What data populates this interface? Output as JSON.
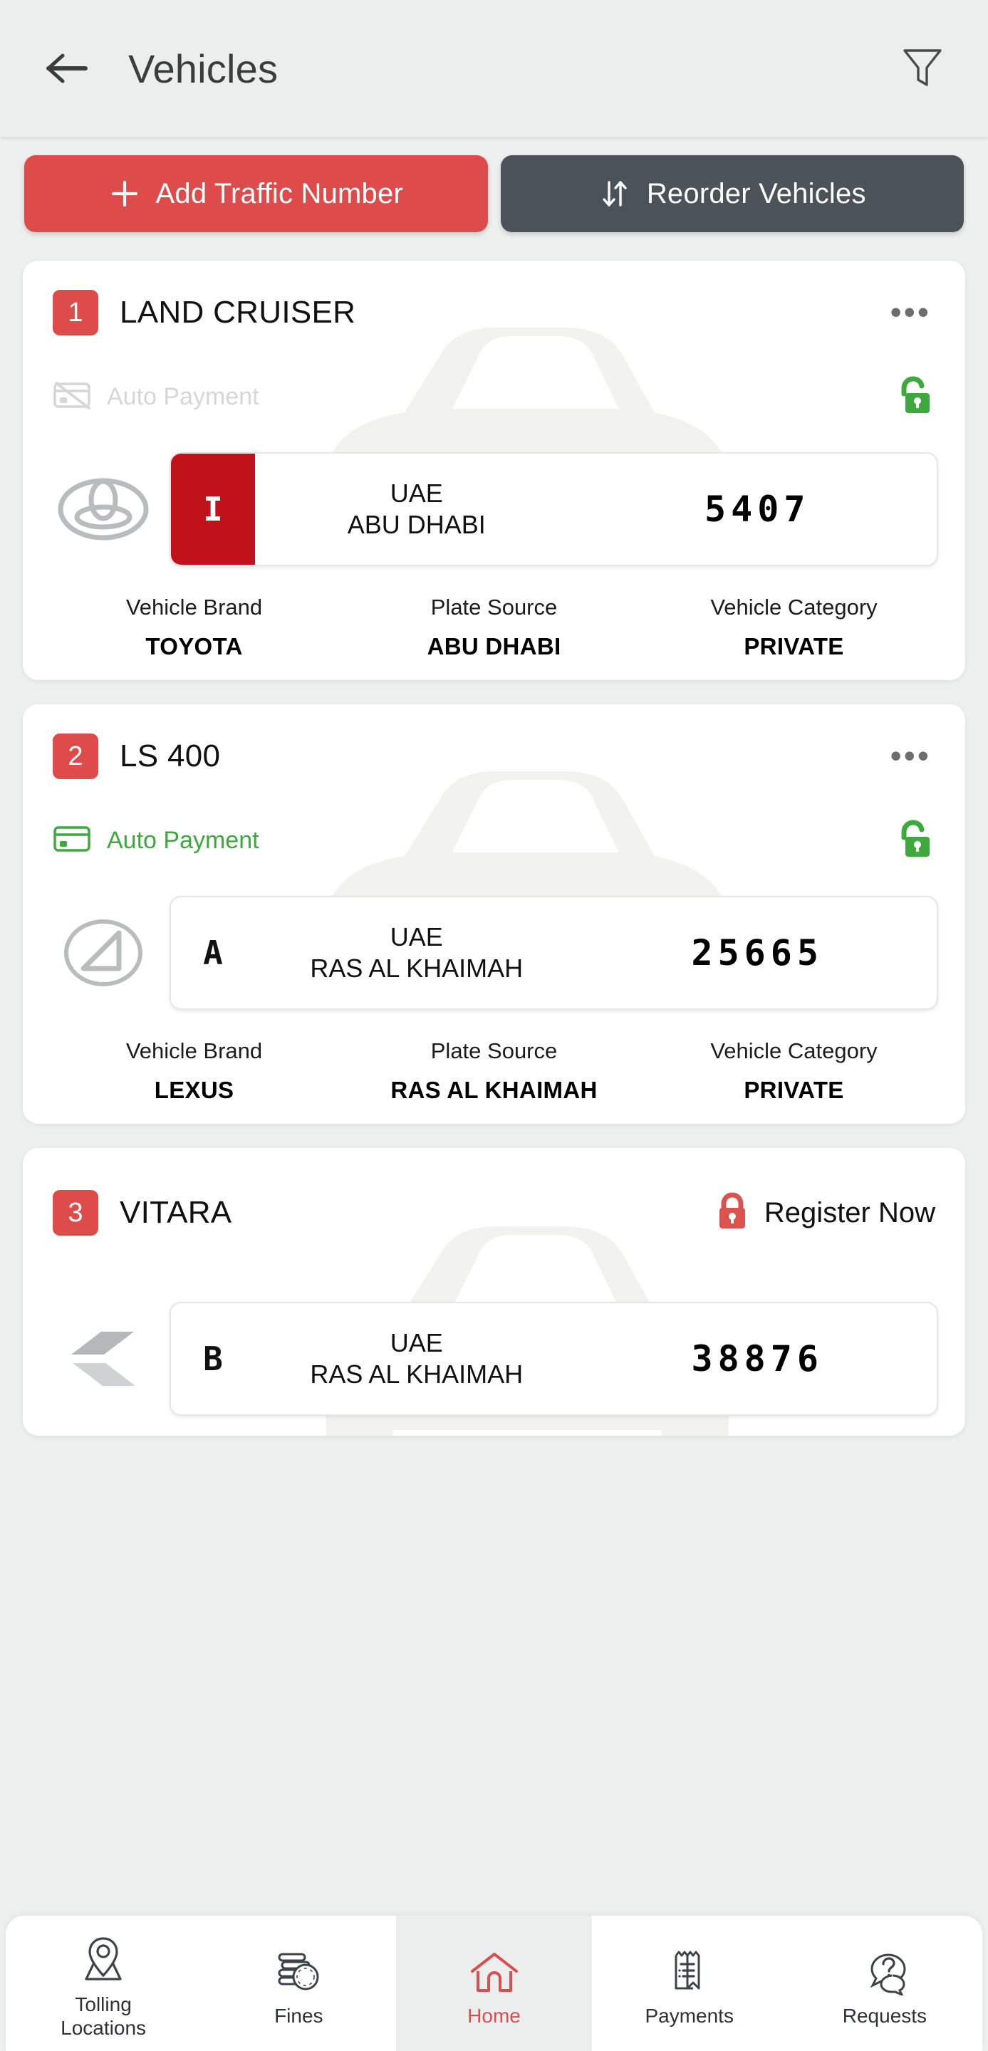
{
  "header": {
    "title": "Vehicles",
    "back_icon": "arrow-left-icon",
    "filter_icon": "filter-icon"
  },
  "toolbar": {
    "add_label": "Add Traffic Number",
    "add_icon": "plus-icon",
    "reorder_label": "Reorder Vehicles",
    "reorder_icon": "sort-arrows-icon"
  },
  "labels": {
    "vehicle_brand": "Vehicle Brand",
    "plate_source": "Plate Source",
    "vehicle_category": "Vehicle Category",
    "auto_payment": "Auto Payment",
    "register_now": "Register Now",
    "menu_dots": "•••"
  },
  "colors": {
    "accent_red": "#dd4b4b",
    "plate_red": "#c1121c",
    "dark_gray": "#4b5359",
    "green": "#3da93d",
    "disabled_gray": "#d6d6d6",
    "nav_active": "#d94f4f"
  },
  "vehicles": [
    {
      "rank": "1",
      "name": "LAND CRUISER",
      "auto_payment": "Auto Payment",
      "auto_payment_active": false,
      "lock_state": "unlocked",
      "brand_logo": "toyota-logo",
      "plate_code": "I",
      "plate_code_red": true,
      "plate_country": "UAE",
      "plate_emirate": "ABU DHABI",
      "plate_number": "5407",
      "brand_value": "TOYOTA",
      "source_value": "ABU DHABI",
      "category_value": "PRIVATE",
      "has_menu": true,
      "has_register": false
    },
    {
      "rank": "2",
      "name": "LS 400",
      "auto_payment": "Auto Payment",
      "auto_payment_active": true,
      "lock_state": "unlocked",
      "brand_logo": "lexus-logo",
      "plate_code": "A",
      "plate_code_red": false,
      "plate_country": "UAE",
      "plate_emirate": "RAS AL KHAIMAH",
      "plate_number": "25665",
      "brand_value": "LEXUS",
      "source_value": "RAS AL KHAIMAH",
      "category_value": "PRIVATE",
      "has_menu": true,
      "has_register": false
    },
    {
      "rank": "3",
      "name": "VITARA",
      "auto_payment": "",
      "auto_payment_active": false,
      "lock_state": "locked",
      "brand_logo": "suzuki-logo",
      "plate_code": "B",
      "plate_code_red": false,
      "plate_country": "UAE",
      "plate_emirate": "RAS AL KHAIMAH",
      "plate_number": "38876",
      "brand_value": "",
      "source_value": "",
      "category_value": "",
      "has_menu": false,
      "has_register": true
    }
  ],
  "bottom_nav": [
    {
      "label": "Tolling\nLocations",
      "icon": "map-pin-icon",
      "active": false
    },
    {
      "label": "Fines",
      "icon": "coins-icon",
      "active": false
    },
    {
      "label": "Home",
      "icon": "home-icon",
      "active": true
    },
    {
      "label": "Payments",
      "icon": "receipt-icon",
      "active": false
    },
    {
      "label": "Requests",
      "icon": "question-bubble-icon",
      "active": false
    }
  ]
}
